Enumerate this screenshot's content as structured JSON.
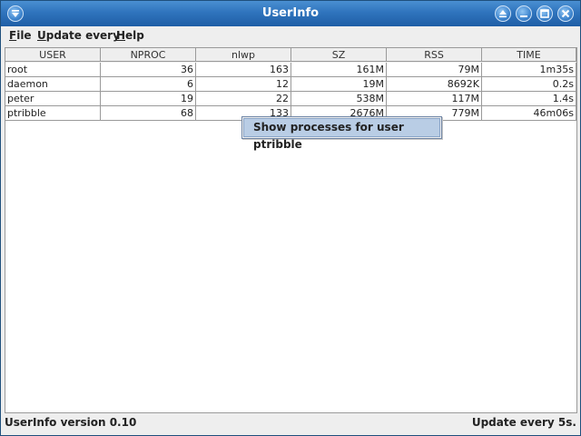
{
  "window": {
    "title": "UserInfo"
  },
  "menubar": {
    "items": [
      {
        "mnemonic": "F",
        "rest": "ile"
      },
      {
        "mnemonic": "U",
        "rest": "pdate every"
      },
      {
        "mnemonic": "H",
        "rest": "elp"
      }
    ]
  },
  "table": {
    "columns": [
      "USER",
      "NPROC",
      "nlwp",
      "SZ",
      "RSS",
      "TIME"
    ],
    "rows": [
      [
        "root",
        "36",
        "163",
        "161M",
        "79M",
        "1m35s"
      ],
      [
        "daemon",
        "6",
        "12",
        "19M",
        "8692K",
        "0.2s"
      ],
      [
        "peter",
        "19",
        "22",
        "538M",
        "117M",
        "1.4s"
      ],
      [
        "ptribble",
        "68",
        "133",
        "2676M",
        "779M",
        "46m06s"
      ]
    ]
  },
  "popup": {
    "item": "Show processes for user ptribble"
  },
  "statusbar": {
    "left": "UserInfo version 0.10",
    "right": "Update every 5s."
  },
  "icons": {
    "window_menu": "window-menu-icon",
    "shade": "shade-icon",
    "minimize": "minimize-icon",
    "maximize": "maximize-icon",
    "close": "close-icon"
  },
  "colors": {
    "titlebar": "#2f74bd",
    "selection": "#b9cde5"
  }
}
